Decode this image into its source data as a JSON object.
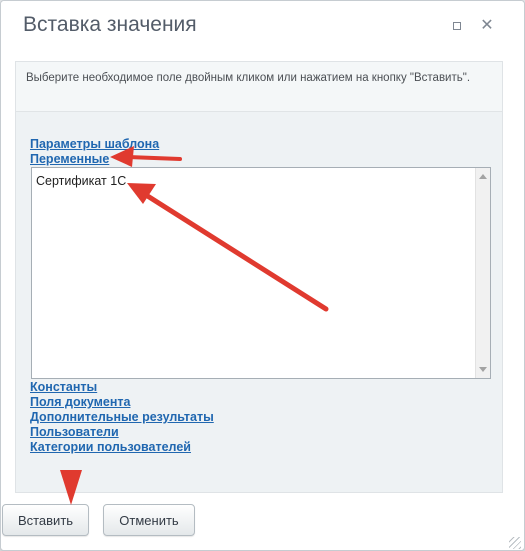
{
  "dialog": {
    "title": "Вставка значения",
    "hint": "Выберите необходимое поле двойным кликом или нажатием на кнопку \"Вставить\"."
  },
  "sections": {
    "template_params": "Параметры шаблона",
    "variables": "Переменные",
    "constants": "Константы",
    "document_fields": "Поля документа",
    "additional_results": "Дополнительные результаты",
    "users": "Пользователи",
    "user_categories": "Категории пользователей"
  },
  "variables_list": [
    "Сертификат 1С"
  ],
  "buttons": {
    "insert": "Вставить",
    "cancel": "Отменить"
  },
  "icons": {
    "maximize": "maximize-icon",
    "close": "close-icon",
    "annotation_arrow": "red-arrow"
  },
  "colors": {
    "link": "#2067b0",
    "annotation": "#e03a2f",
    "title": "#535c69"
  }
}
